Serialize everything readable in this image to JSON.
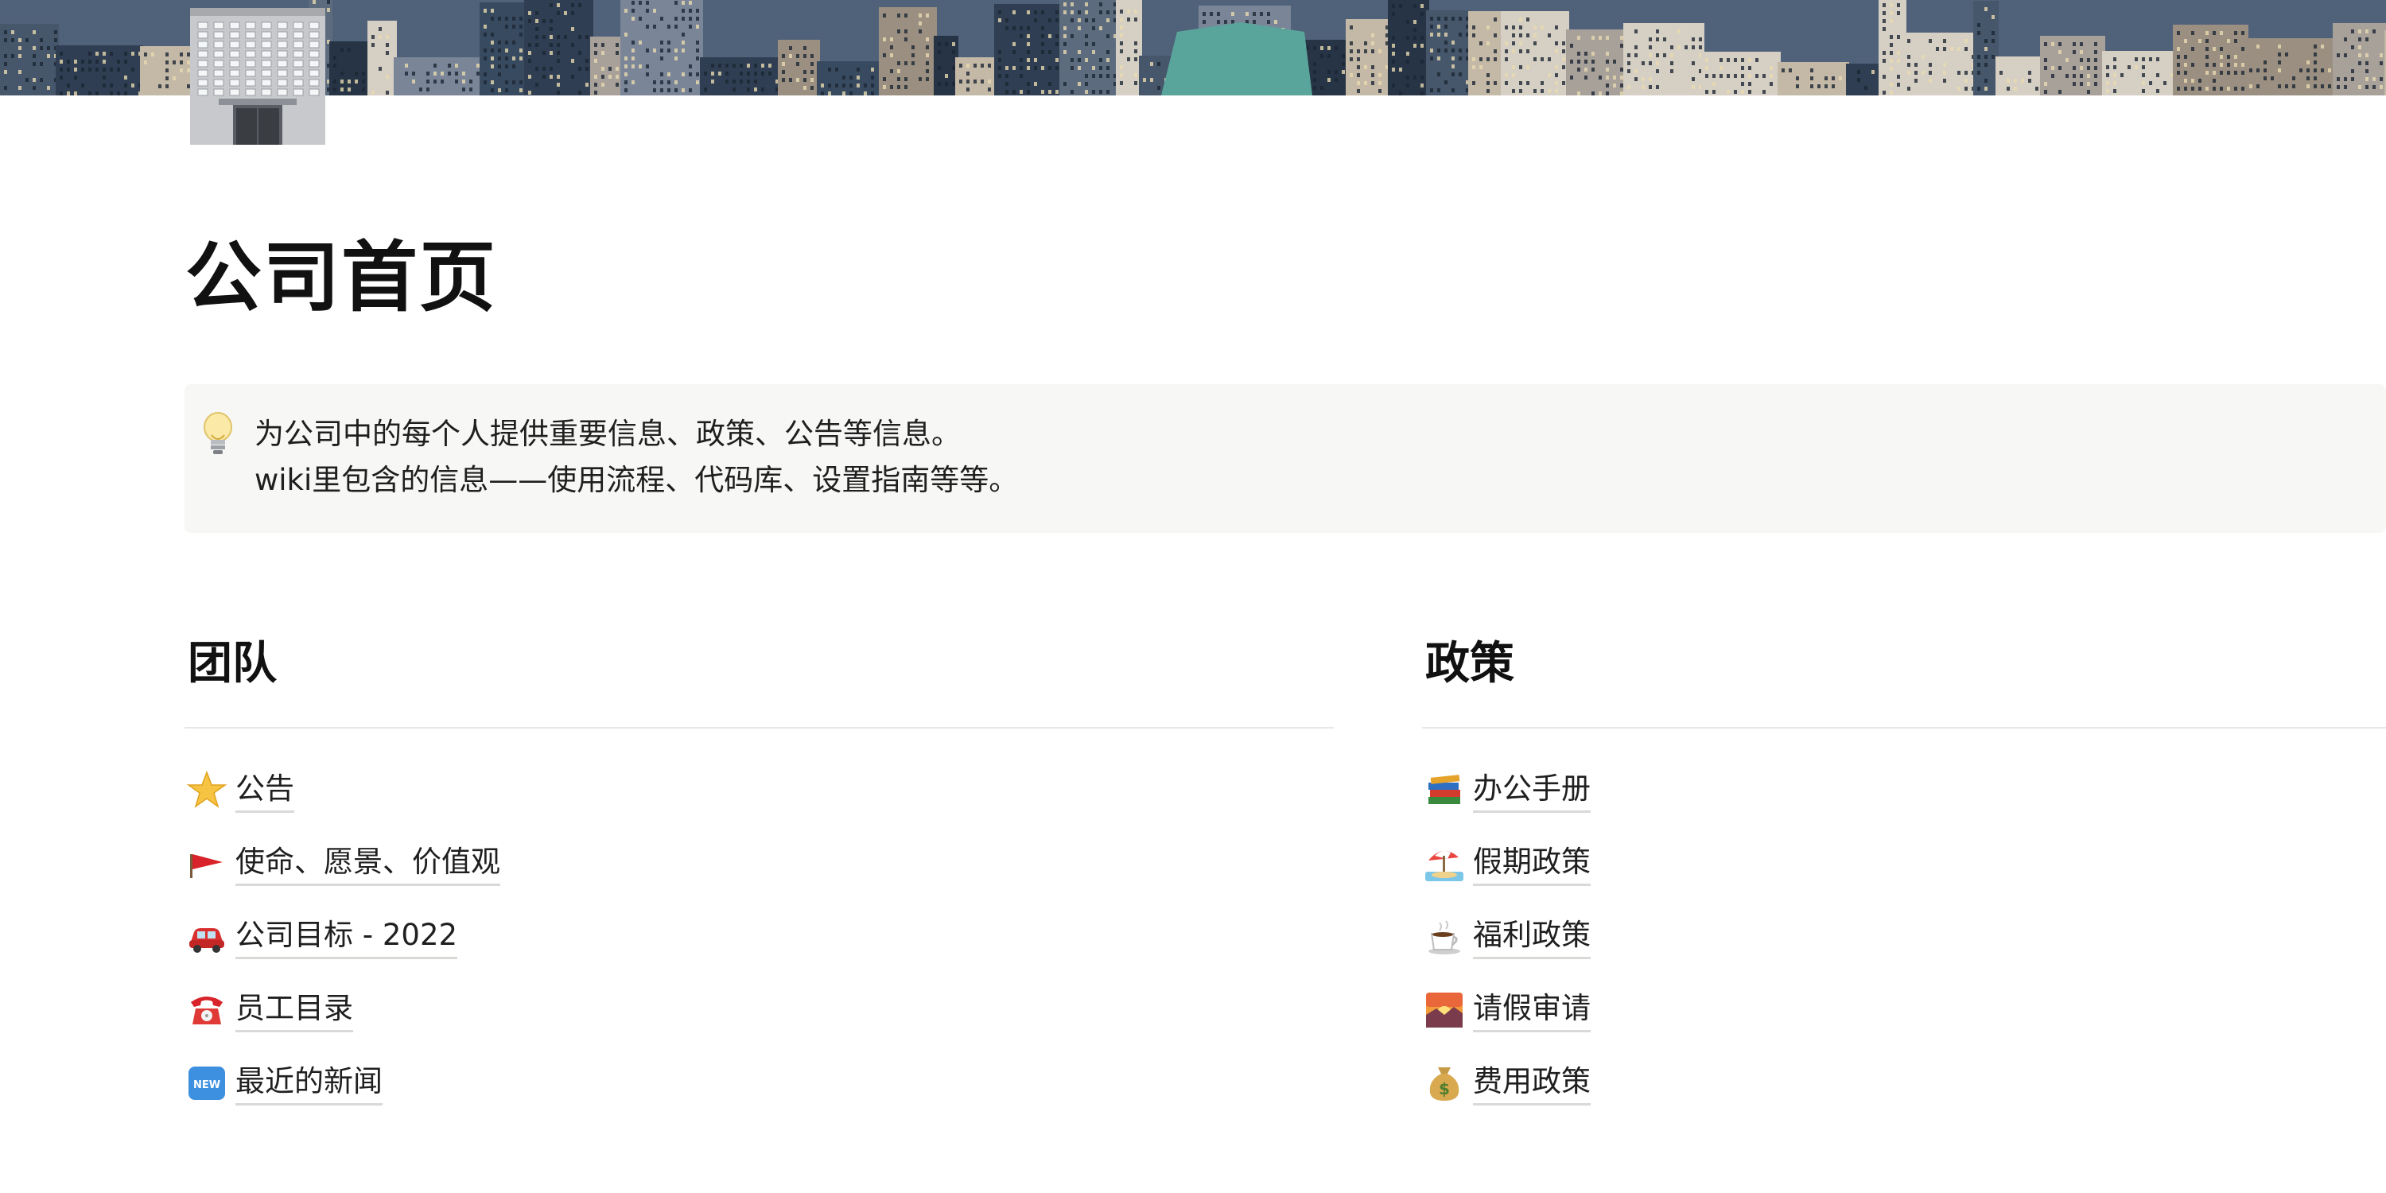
{
  "cover": {
    "image": "city-skyline-cover"
  },
  "page": {
    "icon": "office-building-icon",
    "title": "公司首页"
  },
  "callout": {
    "icon": "lightbulb-icon",
    "lines": [
      "为公司中的每个人提供重要信息、政策、公告等信息。",
      "wiki里包含的信息——使用流程、代码库、设置指南等等。"
    ]
  },
  "sections": [
    {
      "heading": "团队",
      "items": [
        {
          "icon": "star-icon",
          "label": "公告"
        },
        {
          "icon": "red-flag-icon",
          "label": "使命、愿景、价值观"
        },
        {
          "icon": "car-icon",
          "label": "公司目标 - 2022"
        },
        {
          "icon": "telephone-icon",
          "label": "员工目录"
        },
        {
          "icon": "new-badge-icon",
          "label": "最近的新闻"
        }
      ]
    },
    {
      "heading": "政策",
      "items": [
        {
          "icon": "books-icon",
          "label": "办公手册"
        },
        {
          "icon": "beach-umbrella-icon",
          "label": "假期政策"
        },
        {
          "icon": "hot-beverage-icon",
          "label": "福利政策"
        },
        {
          "icon": "sunrise-icon",
          "label": "请假审请"
        },
        {
          "icon": "money-bag-icon",
          "label": "费用政策"
        }
      ]
    }
  ]
}
